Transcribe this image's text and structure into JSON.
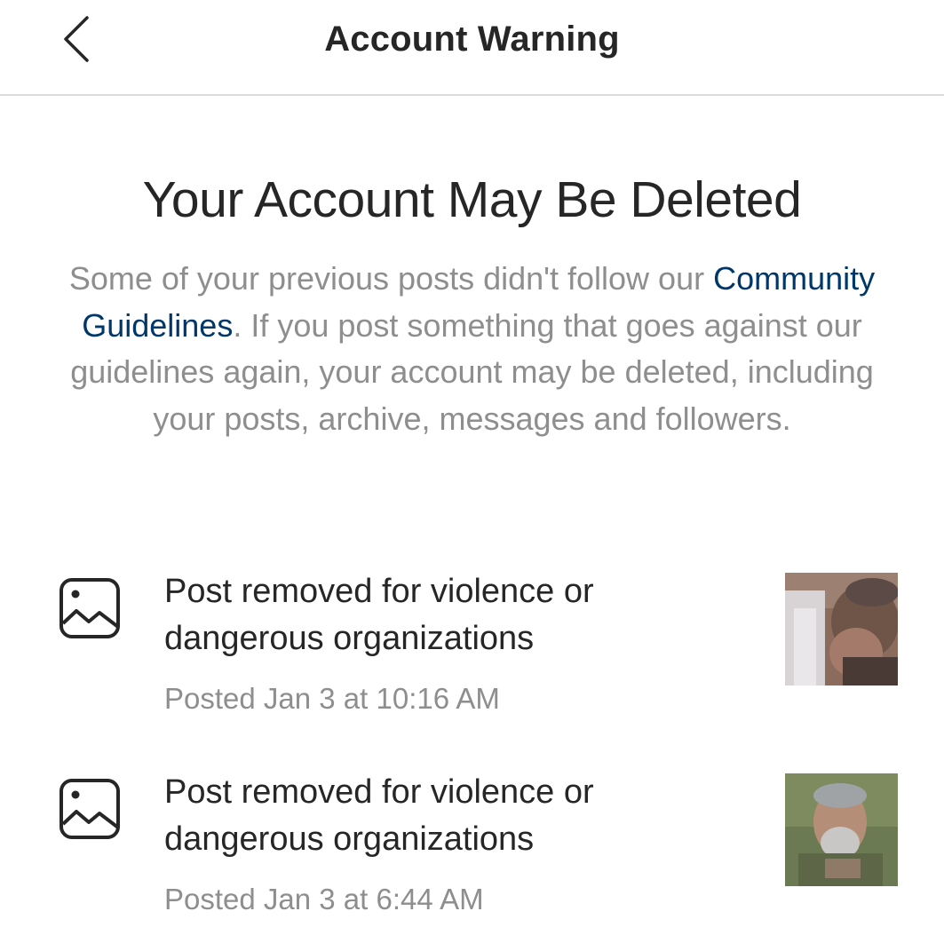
{
  "header": {
    "title": "Account Warning",
    "back_icon": "chevron-left-icon"
  },
  "warning": {
    "title": "Your Account May Be Deleted",
    "body_before_link": "Some of your previous posts didn't follow our",
    "link_text": "Community Guidelines",
    "body_after_link": ". If you post something that goes against our guidelines again, your account may be deleted, including your posts, archive, messages and followers."
  },
  "colors": {
    "text_primary": "#262626",
    "text_secondary": "#8e8e8e",
    "link": "#00376b",
    "divider": "#dbdbdb"
  },
  "removed_posts": [
    {
      "icon": "image-icon",
      "reason": "Post removed for violence or dangerous organizations",
      "date": "Posted Jan 3 at 10:16 AM",
      "thumbnail": "post-thumbnail"
    },
    {
      "icon": "image-icon",
      "reason": "Post removed for violence or dangerous organizations",
      "date": "Posted Jan 3 at 6:44 AM",
      "thumbnail": "post-thumbnail"
    }
  ]
}
